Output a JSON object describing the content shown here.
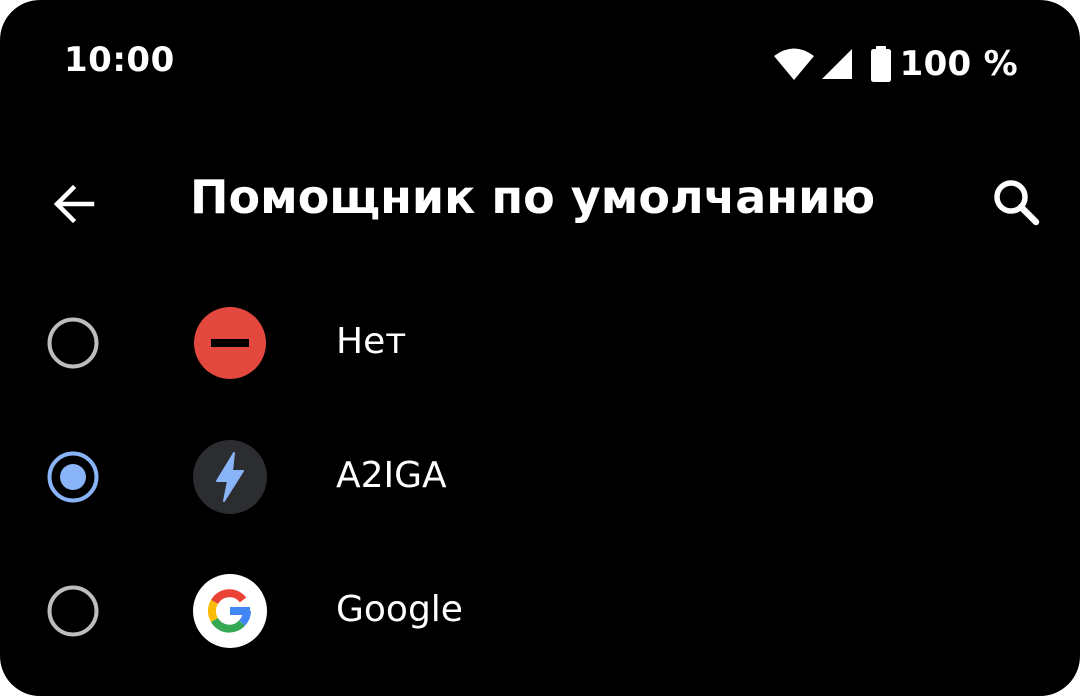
{
  "status_bar": {
    "time": "10:00",
    "battery": "100 %",
    "icons": [
      "wifi-icon",
      "cell-signal-icon",
      "battery-icon"
    ]
  },
  "app_bar": {
    "title": "Помощник по умолчанию",
    "back_icon": "arrow-back-icon",
    "search_icon": "search-icon"
  },
  "options": [
    {
      "label": "Нет",
      "icon": "none-icon",
      "selected": false
    },
    {
      "label": "A2IGA",
      "icon": "bolt-icon",
      "selected": true
    },
    {
      "label": "Google",
      "icon": "google-icon",
      "selected": false
    }
  ],
  "colors": {
    "background": "#000000",
    "accent": "#8AB4F8",
    "radio_off": "#BDBDBD",
    "none_icon": "#E2483D"
  }
}
